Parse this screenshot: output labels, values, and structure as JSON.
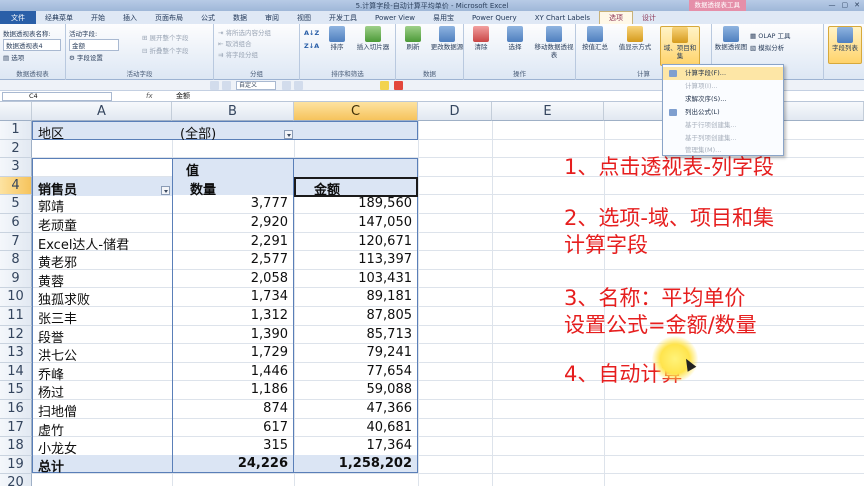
{
  "window": {
    "title": "5.计算字段-自动计算平均单价 - Microsoft Excel",
    "context_tab_group": "数据透视表工具",
    "controls": [
      "—",
      "▢",
      "✕"
    ]
  },
  "menu": {
    "file": "文件",
    "tabs": [
      "经典菜单",
      "开始",
      "插入",
      "页面布局",
      "公式",
      "数据",
      "审阅",
      "视图",
      "开发工具",
      "Power View",
      "易用宝",
      "Power Query",
      "XY Chart Labels",
      "选项",
      "设计"
    ],
    "active_tab": "选项"
  },
  "ribbon": {
    "pivot_name_label": "数据透视表名称:",
    "pivot_name": "数据透视表4",
    "options_btn": "选项",
    "active_field_label": "活动字段:",
    "active_field": "金额",
    "field_settings": "字段设置",
    "expand_field": "展开整个字段",
    "collapse_field": "折叠整个字段",
    "group_selection": "将所选内容分组",
    "ungroup": "取消组合",
    "group_field": "将字段分组",
    "sort_asc": "A↓Z",
    "sort_desc": "Z↓A",
    "sort": "排序",
    "insert_slicer": "插入切片器",
    "refresh": "刷新",
    "change_source": "更改数据源",
    "clear": "清除",
    "select": "选择",
    "move_pivot": "移动数据透视表",
    "summarize_by": "按值汇总",
    "show_values_as": "值显示方式",
    "fields_items_sets": "域、项目和集",
    "pivot_chart": "数据透视图",
    "olap_tools": "OLAP 工具",
    "what_if": "模拟分析",
    "field_list": "字段列表",
    "groups": {
      "pivot": "数据透视表",
      "active_field": "活动字段",
      "grouping": "分组",
      "sort_filter": "排序和筛选",
      "data": "数据",
      "actions": "操作",
      "calculations": "计算",
      "tools": "工具"
    }
  },
  "dropdown": {
    "items": [
      {
        "label": "计算字段(F)...",
        "disabled": false,
        "highlighted": true
      },
      {
        "label": "计算项(I)...",
        "disabled": true,
        "highlighted": false
      },
      {
        "label": "求解次序(S)...",
        "disabled": false,
        "highlighted": false
      },
      {
        "label": "列出公式(L)",
        "disabled": false,
        "highlighted": false
      },
      {
        "label": "基于行项创建集...",
        "disabled": true,
        "highlighted": false
      },
      {
        "label": "基于列项创建集...",
        "disabled": true,
        "highlighted": false
      },
      {
        "label": "管理集(M)...",
        "disabled": true,
        "highlighted": false
      }
    ]
  },
  "format_bar": {
    "font_size": "自定义"
  },
  "formula_bar": {
    "name_box": "C4",
    "fx": "fx",
    "content": "金额"
  },
  "sheet": {
    "columns": [
      "A",
      "B",
      "C",
      "D",
      "E"
    ],
    "selected_column": "C",
    "selected_row": "4",
    "row_numbers": [
      "1",
      "2",
      "3",
      "4",
      "5",
      "6",
      "7",
      "8",
      "9",
      "10",
      "11",
      "12",
      "13",
      "14",
      "15",
      "16",
      "17",
      "18",
      "19",
      "20"
    ],
    "filter_field": "地区",
    "filter_value": "(全部)",
    "values_header": "值",
    "row_label": "销售员",
    "col_qty": "数量",
    "col_amount": "金额",
    "rows": [
      {
        "name": "郭靖",
        "qty": "3,777",
        "amount": "189,560"
      },
      {
        "name": "老顽童",
        "qty": "2,920",
        "amount": "147,050"
      },
      {
        "name": "Excel达人-储君",
        "qty": "2,291",
        "amount": "120,671"
      },
      {
        "name": "黄老邪",
        "qty": "2,577",
        "amount": "113,397"
      },
      {
        "name": "黄蓉",
        "qty": "2,058",
        "amount": "103,431"
      },
      {
        "name": "独孤求败",
        "qty": "1,734",
        "amount": "89,181"
      },
      {
        "name": "张三丰",
        "qty": "1,312",
        "amount": "87,805"
      },
      {
        "name": "段誉",
        "qty": "1,390",
        "amount": "85,713"
      },
      {
        "name": "洪七公",
        "qty": "1,729",
        "amount": "79,241"
      },
      {
        "name": "乔峰",
        "qty": "1,446",
        "amount": "77,654"
      },
      {
        "name": "杨过",
        "qty": "1,186",
        "amount": "59,088"
      },
      {
        "name": "扫地僧",
        "qty": "874",
        "amount": "47,366"
      },
      {
        "name": "虚竹",
        "qty": "617",
        "amount": "40,681"
      },
      {
        "name": "小龙女",
        "qty": "315",
        "amount": "17,364"
      }
    ],
    "total_label": "总计",
    "total_qty": "24,226",
    "total_amount": "1,258,202"
  },
  "annotations": {
    "step1": "1、点击透视表-列字段",
    "step2a": "2、选项-域、项目和集",
    "step2b": "计算字段",
    "step3a": "3、名称：平均单价",
    "step3b": "设置公式=金额/数量",
    "step4": "4、自动计算",
    "color": "#e61e1e"
  },
  "colors": {
    "file_tab": "#2a5fa8",
    "context_tab": "#e58fa9",
    "pivot_border": "#5a7fb8",
    "pivot_band": "#dbe5f4",
    "selection_header": "#f6c35c"
  }
}
